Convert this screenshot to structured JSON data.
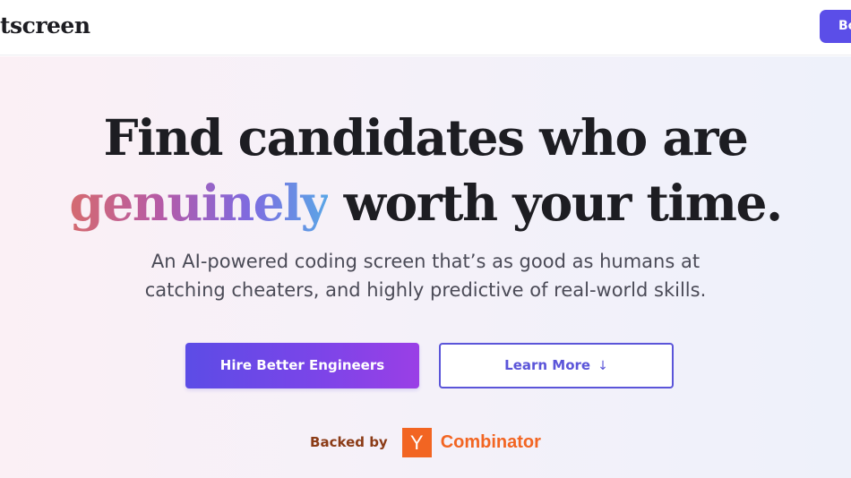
{
  "nav": {
    "brand": "tscreen",
    "cta_label": "Bo"
  },
  "hero": {
    "headline_line1": "Find candidates who are",
    "headline_highlight": "genuinely",
    "headline_line2_rest": " worth your time.",
    "subhead_line1": "An AI-powered coding screen that’s as good as humans at",
    "subhead_line2": "catching cheaters, and highly predictive of real-world skills.",
    "primary_button": "Hire Better Engineers",
    "secondary_button": "Learn More",
    "secondary_icon": "arrow-down-icon"
  },
  "backing": {
    "label": "Backed by",
    "logo_letter": "Y",
    "logo_word": "Combinator"
  },
  "colors": {
    "accent": "#5b4ee8",
    "secondary_border": "#5b55d9",
    "yc_orange": "#f26522",
    "backed_label": "#8b3b16",
    "headline": "#1d1d22"
  }
}
